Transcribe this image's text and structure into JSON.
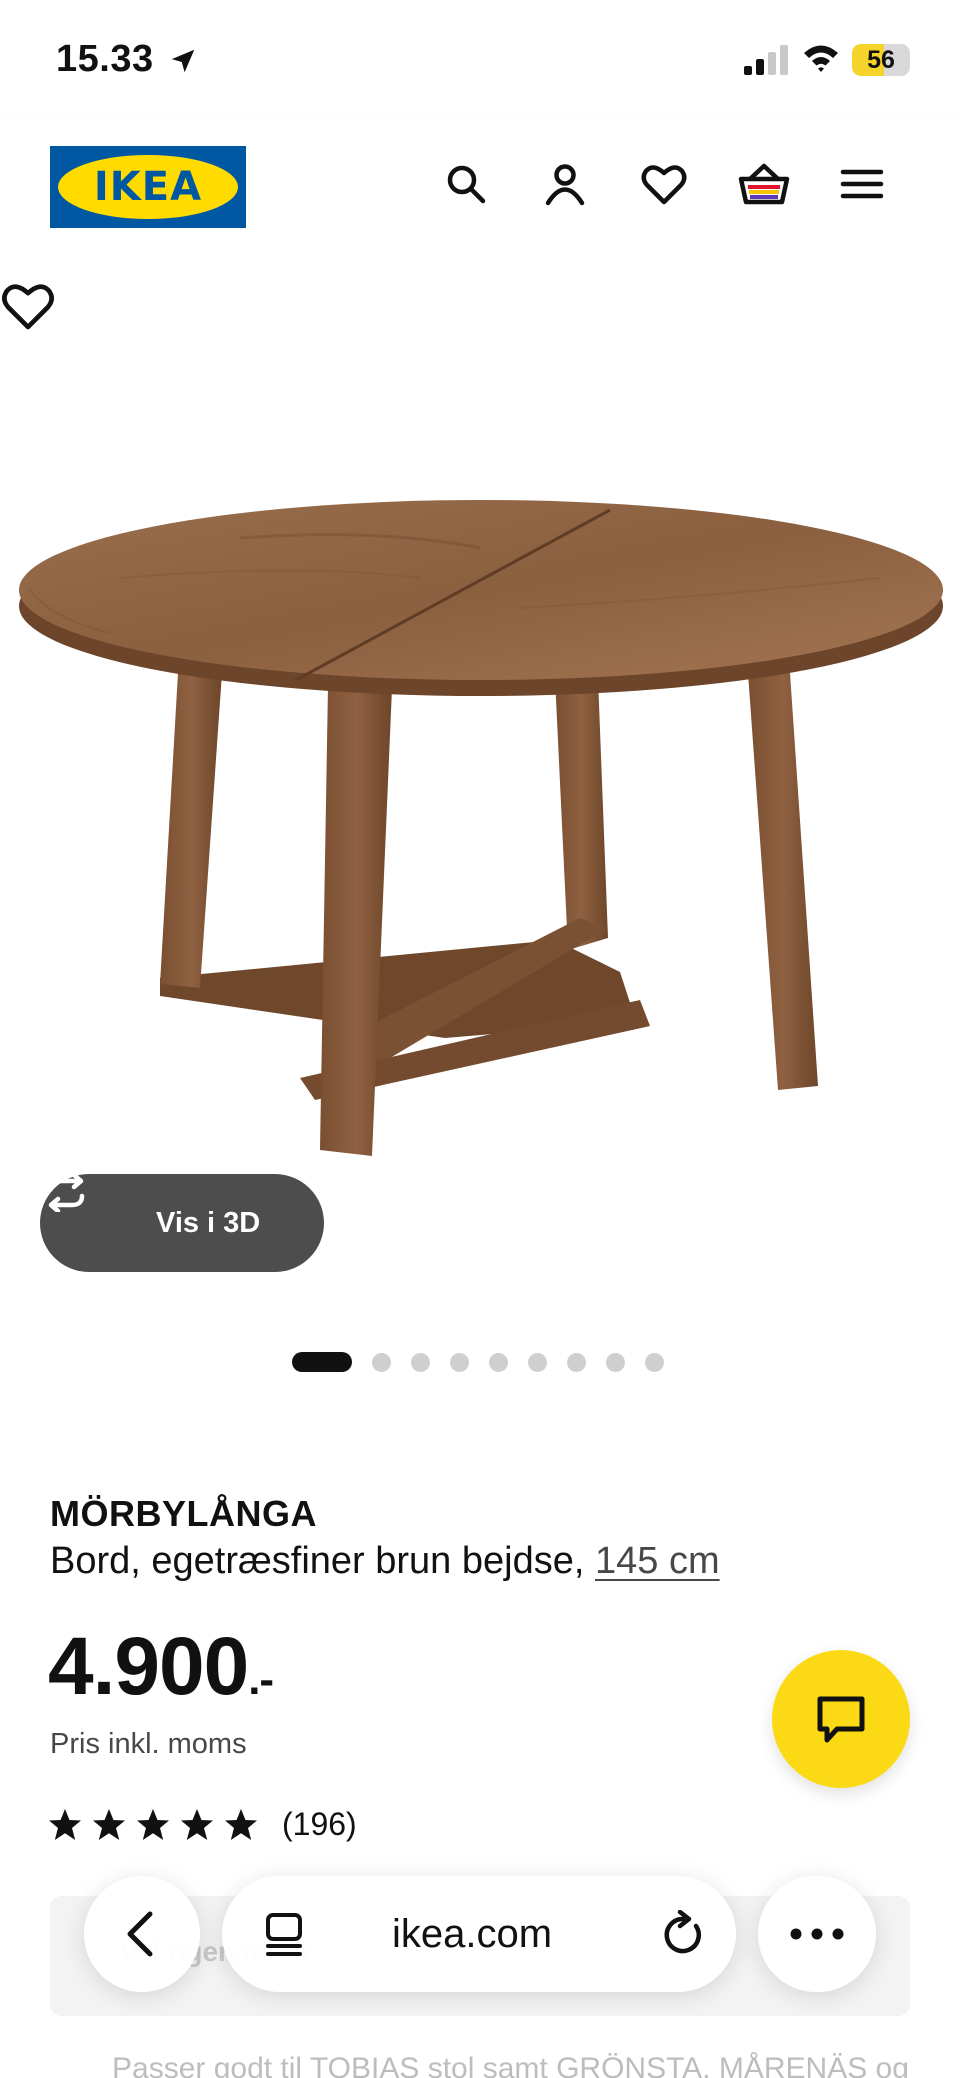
{
  "status_bar": {
    "time": "15.33",
    "battery": "56",
    "battery_level": 0.56,
    "icons": [
      "location-arrow-icon",
      "signal-icon",
      "wifi-icon",
      "battery-icon"
    ]
  },
  "header": {
    "logo_text": "IKEA",
    "icons": [
      "search-icon",
      "account-icon",
      "heart-icon",
      "cart-icon",
      "menu-icon"
    ],
    "brand_colors": {
      "blue": "#0058a3",
      "yellow": "#ffdb00"
    }
  },
  "gallery": {
    "view_3d_label": "Vis i 3D",
    "total_images": 10,
    "active_index": 0
  },
  "product": {
    "name": "MÖRBYLÅNGA",
    "description": "Bord, egetræsfiner brun bejdse, ",
    "size_link": "145 cm",
    "price": "4.900",
    "price_suffix": ".-",
    "price_note": "Pris inkl. moms",
    "rating": 5,
    "review_count": "(196)"
  },
  "faded_content": {
    "promo_text": "Vel   ngen   idder",
    "suggestion_text": "Passer godt til TOBIAS stol samt GRÖNSTA, MÅRENÄS og"
  },
  "browser": {
    "url": "ikea.com"
  },
  "colors": {
    "chat_button": "#fbd914",
    "view_3d_bg": "#4d4d4d",
    "wood": "#8a5d3b"
  }
}
